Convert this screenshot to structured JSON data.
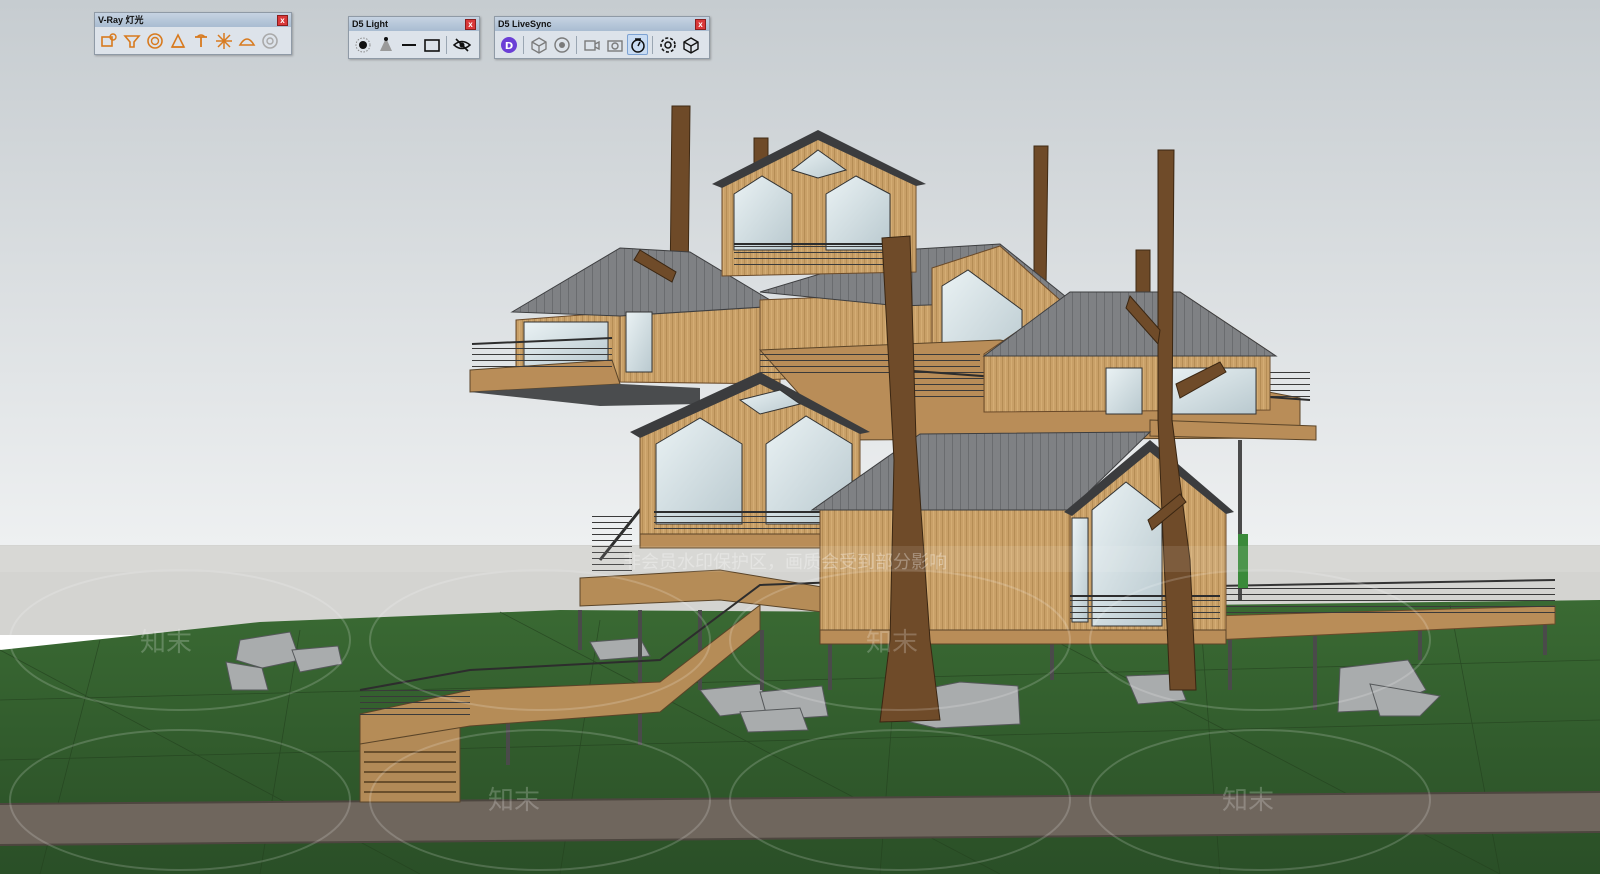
{
  "toolbars": {
    "vray": {
      "title": "V-Ray 灯光",
      "close_label": "x",
      "tools": [
        "vray-rect-light-icon",
        "vray-spot-light-icon",
        "vray-sphere-light-icon",
        "vray-ies-light-icon",
        "vray-omni-light-icon",
        "vray-dome-light-icon",
        "vray-mesh-light-icon",
        "vray-light-gen-icon"
      ]
    },
    "d5light": {
      "title": "D5 Light",
      "close_label": "x",
      "tools": [
        "point-light-icon",
        "spot-light-icon",
        "strip-light-icon",
        "rect-light-icon",
        "hide-lights-icon"
      ]
    },
    "d5sync": {
      "title": "D5 LiveSync",
      "close_label": "x",
      "tools": [
        "d5-start-icon",
        "sync-model-icon",
        "sync-toggle-icon",
        "camera-sync-icon",
        "screenshot-icon",
        "auto-sync-icon",
        "d5-settings-icon",
        "export-model-icon"
      ]
    }
  },
  "watermark": {
    "banner": "非会员水印保护区，画质会受到部分影响",
    "mark": "知末"
  },
  "colors": {
    "sky_top": "#c8cdd1",
    "sky_bottom": "#eef0f1",
    "ground": "#2f5a2c",
    "road": "#6b6259",
    "wood": "#c49a62",
    "roof": "#7d7f82",
    "trunk": "#6e4b2a",
    "vray_icon": "#e07e22",
    "d5_purple": "#6b3fd6"
  }
}
